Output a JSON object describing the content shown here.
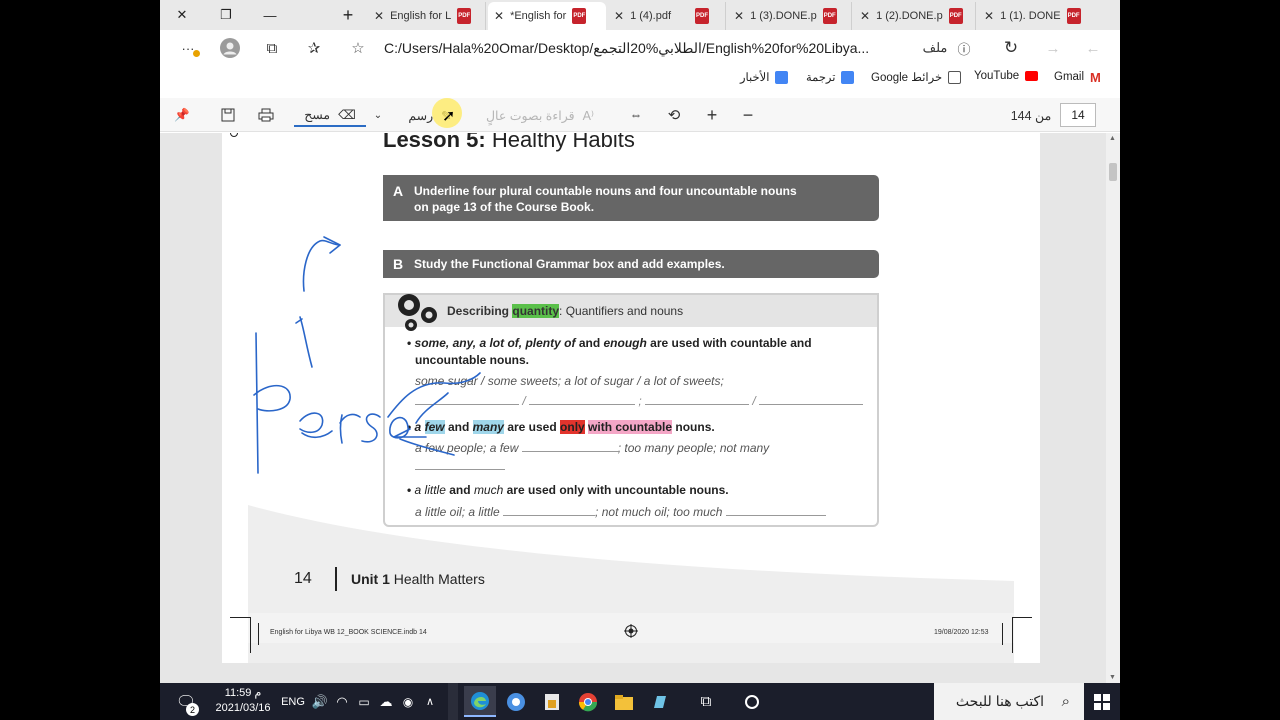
{
  "browser": {
    "tabs": [
      {
        "label": "English for L",
        "active": false
      },
      {
        "label": "*English for",
        "active": true
      },
      {
        "label": "1 (4).pdf",
        "active": false
      },
      {
        "label": "1 (3).DONE.p",
        "active": false
      },
      {
        "label": "1 (2).DONE.p",
        "active": false
      },
      {
        "label": "1 (1). DONE",
        "active": false
      }
    ],
    "address": "C:/Users/Hala%20Omar/Desktop/الطلابي%20التجمع/English%20for%20Libya...",
    "file_label": "ملف",
    "favorites": [
      {
        "label": "Gmail",
        "icon": "gmail-icon",
        "color": "#d93025"
      },
      {
        "label": "YouTube",
        "icon": "youtube-icon",
        "color": "#ff0000"
      },
      {
        "label": "Google خرائط",
        "icon": "page-icon",
        "color": "#ffffff"
      },
      {
        "label": "ترجمة",
        "icon": "translate-icon",
        "color": "#4285f4"
      },
      {
        "label": "الأخبار",
        "icon": "news-icon",
        "color": "#4285f4"
      }
    ]
  },
  "pdf_toolbar": {
    "erase_label": "مسح",
    "draw_label": "رسم",
    "read_aloud_label": "قراءة بصوت عالٍ",
    "page_current": "14",
    "page_total": "من 144"
  },
  "document": {
    "lesson_prefix": "Lesson 5:",
    "lesson_title": "Healthy Habits",
    "a_letter": "A",
    "a_line1": "Underline four plural countable nouns and four uncountable nouns",
    "a_line2": "on page 13 of the Course Book.",
    "b_letter": "B",
    "b_text": "Study the Functional Grammar box and add examples.",
    "grammar_head_pre": "Describing ",
    "grammar_head_hl": "quantity",
    "grammar_head_post": ": Quantifiers and nouns",
    "rule1_line1_italic": "some, any, a lot of, plenty of",
    "rule1_and": "and",
    "rule1_enough": "enough",
    "rule1_rest": "are used with countable and",
    "rule1_line2": "uncountable nouns.",
    "ex1": "some sugar / some sweets; a lot of sugar / a lot of sweets;",
    "rule2_a": "a",
    "rule2_few": "few",
    "rule2_and": "and",
    "rule2_many": "many",
    "rule2_used": "are used",
    "rule2_only": "only",
    "rule2_with": "with countable",
    "rule2_nouns": "nouns.",
    "ex2_a": "a few people; a few",
    "ex2_b": "; too many people; not many",
    "rule3_little": "a little",
    "rule3_and": "and",
    "rule3_much": "much",
    "rule3_rest": "are used only with uncountable nouns.",
    "ex3_a": "a little oil; a little",
    "ex3_b": "; not much oil; too much",
    "page_number": "14",
    "unit_bold": "Unit 1",
    "unit_title": "Health Matters",
    "print_left": "English for Libya WB 12_BOOK SCIENCE.indb   14",
    "print_right": "19/08/2020   12:53"
  },
  "taskbar": {
    "search_placeholder": "اكتب هنا للبحث",
    "time": "11:59 م",
    "date": "2021/03/16",
    "language": "ENG",
    "notification_count": "2"
  }
}
